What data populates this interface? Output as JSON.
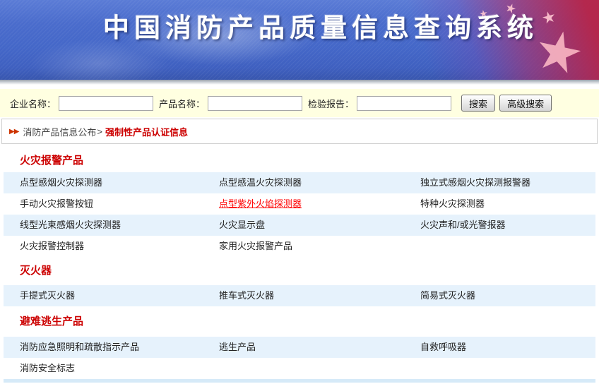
{
  "banner": {
    "title": "中国消防产品质量信息查询系统"
  },
  "search_bar": {
    "company_label": "企业名称：",
    "product_label": "产品名称：",
    "report_label": "检验报告：",
    "company_value": "",
    "product_value": "",
    "report_value": "",
    "search_button": "搜索",
    "advanced_search_button": "高级搜索"
  },
  "breadcrumb": {
    "marker": "▶▶",
    "parent": "消防产品信息公布",
    "separator": ">",
    "current": "强制性产品认证信息"
  },
  "sections": [
    {
      "title": "火灾报警产品",
      "rows": [
        {
          "cells": [
            {
              "label": "点型感烟火灾探测器"
            },
            {
              "label": "点型感温火灾探测器"
            },
            {
              "label": "独立式感烟火灾探测报警器"
            }
          ]
        },
        {
          "cells": [
            {
              "label": "手动火灾报警按钮"
            },
            {
              "label": "点型紫外火焰探测器",
              "highlighted": true
            },
            {
              "label": "特种火灾探测器"
            }
          ]
        },
        {
          "cells": [
            {
              "label": "线型光束感烟火灾探测器"
            },
            {
              "label": "火灾显示盘"
            },
            {
              "label": "火灾声和/或光警报器"
            }
          ]
        },
        {
          "cells": [
            {
              "label": "火灾报警控制器"
            },
            {
              "label": "家用火灾报警产品"
            }
          ]
        }
      ]
    },
    {
      "title": "灭火器",
      "rows": [
        {
          "cells": [
            {
              "label": "手提式灭火器"
            },
            {
              "label": "推车式灭火器"
            },
            {
              "label": "简易式灭火器"
            }
          ]
        }
      ]
    },
    {
      "title": "避难逃生产品",
      "rows": [
        {
          "cells": [
            {
              "label": "消防应急照明和疏散指示产品"
            },
            {
              "label": "逃生产品"
            },
            {
              "label": "自救呼吸器"
            }
          ]
        },
        {
          "cells": [
            {
              "label": "消防安全标志"
            }
          ]
        }
      ]
    }
  ],
  "colors": {
    "banner_blue": "#4467c8",
    "flag_red": "#b92346",
    "search_bg": "#ffffe1",
    "accent_red": "#cc0000",
    "row_blue": "#e6f2fc",
    "link_hover_red": "#ff0000"
  }
}
